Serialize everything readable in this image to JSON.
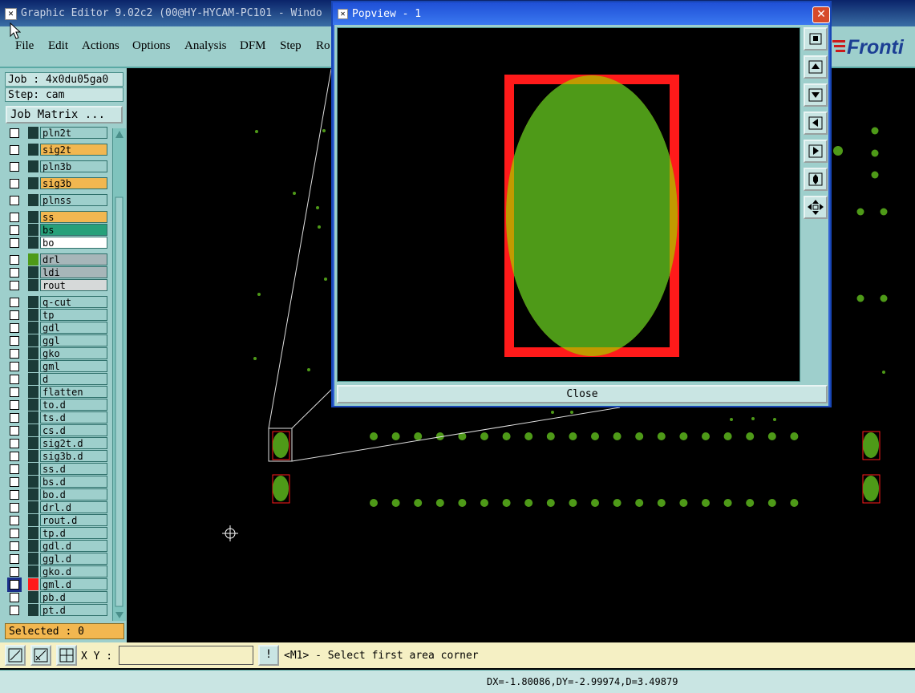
{
  "window": {
    "title": "Graphic Editor 9.02c2 (00@HY-HYCAM-PC101 - Windo",
    "logo": "Fronti"
  },
  "menu": [
    "File",
    "Edit",
    "Actions",
    "Options",
    "Analysis",
    "DFM",
    "Step",
    "Ro"
  ],
  "job_panel": {
    "job": "Job : 4x0du05ga0",
    "step": "Step: cam",
    "job_matrix": "Job Matrix ...",
    "selected": "Selected : 0"
  },
  "layers": [
    {
      "name": "pln2t",
      "bg": "#9ecfcc"
    },
    {
      "name": "sig2t",
      "bg": "#f2b750"
    },
    {
      "name": "pln3b",
      "bg": "#9ecfcc"
    },
    {
      "name": "sig3b",
      "bg": "#f2b750"
    },
    {
      "name": "plnss",
      "bg": "#9ecfcc"
    },
    {
      "name": "ss",
      "bg": "#f2b750"
    },
    {
      "name": "bs",
      "bg": "#26a07a"
    },
    {
      "name": "bo",
      "bg": "#ffffff"
    },
    {
      "name": "drl",
      "bg": "#a7b6b9",
      "indicator": "#4e9a18"
    },
    {
      "name": "ldi",
      "bg": "#a7b6b9"
    },
    {
      "name": "rout",
      "bg": "#d6d9d9"
    },
    {
      "name": "q-cut",
      "bg": "#9ecfcc"
    },
    {
      "name": "tp",
      "bg": "#9ecfcc"
    },
    {
      "name": "gdl",
      "bg": "#9ecfcc"
    },
    {
      "name": "ggl",
      "bg": "#9ecfcc"
    },
    {
      "name": "gko",
      "bg": "#9ecfcc"
    },
    {
      "name": "gml",
      "bg": "#9ecfcc"
    },
    {
      "name": "d",
      "bg": "#9ecfcc"
    },
    {
      "name": "flatten",
      "bg": "#9ecfcc"
    },
    {
      "name": "to.d",
      "bg": "#9ecfcc"
    },
    {
      "name": "ts.d",
      "bg": "#9ecfcc"
    },
    {
      "name": "cs.d",
      "bg": "#9ecfcc"
    },
    {
      "name": "sig2t.d",
      "bg": "#9ecfcc"
    },
    {
      "name": "sig3b.d",
      "bg": "#9ecfcc"
    },
    {
      "name": "ss.d",
      "bg": "#9ecfcc"
    },
    {
      "name": "bs.d",
      "bg": "#9ecfcc"
    },
    {
      "name": "bo.d",
      "bg": "#9ecfcc"
    },
    {
      "name": "drl.d",
      "bg": "#9ecfcc"
    },
    {
      "name": "rout.d",
      "bg": "#9ecfcc"
    },
    {
      "name": "tp.d",
      "bg": "#9ecfcc"
    },
    {
      "name": "gdl.d",
      "bg": "#9ecfcc"
    },
    {
      "name": "ggl.d",
      "bg": "#9ecfcc"
    },
    {
      "name": "gko.d",
      "bg": "#9ecfcc"
    },
    {
      "name": "gml.d",
      "bg": "#9ecfcc",
      "indicator": "#ff1a1a",
      "active": true
    },
    {
      "name": "pb.d",
      "bg": "#9ecfcc"
    },
    {
      "name": "pt.d",
      "bg": "#9ecfcc"
    }
  ],
  "bottom": {
    "xy_label": "X Y :",
    "xy_value": "",
    "message": "<M1> - Select first area corner"
  },
  "status": {
    "measure": "DX=-1.80086,DY=-2.99974,D=3.49879"
  },
  "popview": {
    "title": "Popview - 1",
    "close_label": "Close"
  },
  "colors": {
    "pad": "#4e9a18",
    "outline": "#ff1a1a",
    "panel": "#9ecfcc",
    "highlight": "#f2b750"
  }
}
